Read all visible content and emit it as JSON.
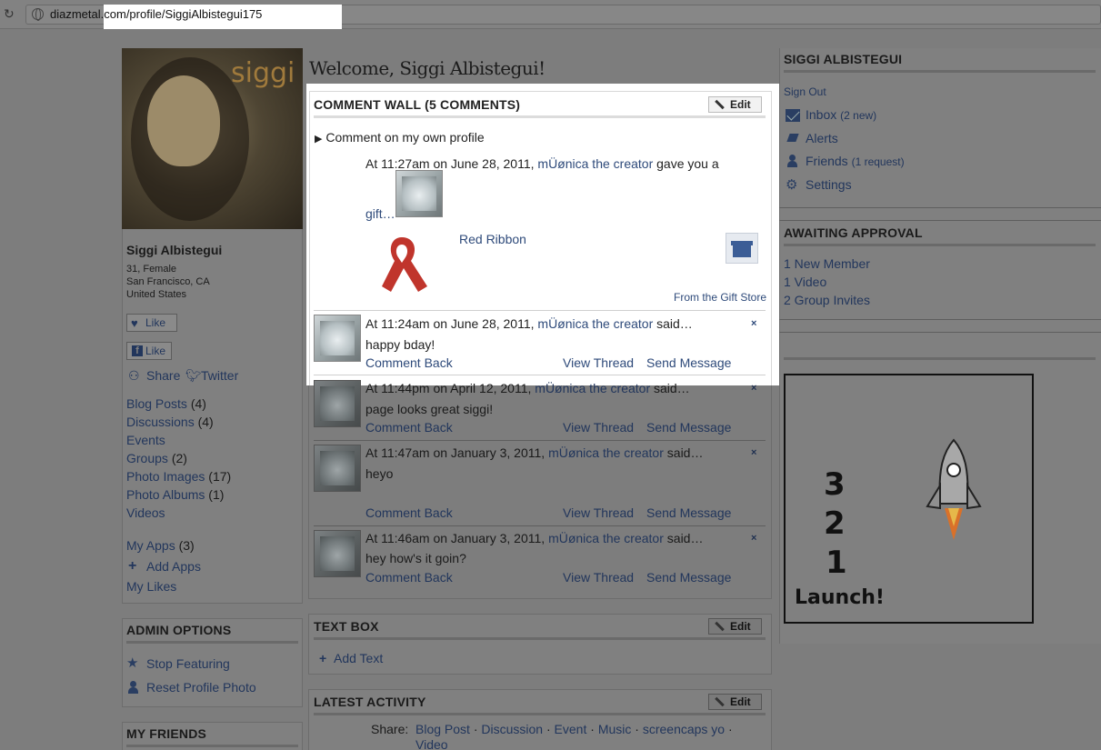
{
  "browser": {
    "url_host": "diazmetal.com",
    "url_path": "/profile/SiggiAlbistegui175"
  },
  "profile": {
    "photo_caption": "siggi",
    "name": "Siggi Albistegui",
    "age_gender": "31, Female",
    "city": "San Francisco, CA",
    "country": "United States",
    "like_label": "Like",
    "fb_like_label": "Like",
    "share_label": "Share",
    "twitter_label": "Twitter"
  },
  "left_nav": [
    {
      "label": "Blog Posts",
      "count": "(4)"
    },
    {
      "label": "Discussions",
      "count": "(4)"
    },
    {
      "label": "Events",
      "count": ""
    },
    {
      "label": "Groups",
      "count": "(2)"
    },
    {
      "label": "Photo Images",
      "count": "(17)"
    },
    {
      "label": "Photo Albums",
      "count": "(1)"
    },
    {
      "label": "Videos",
      "count": ""
    }
  ],
  "apps": {
    "my_apps": "My Apps",
    "my_apps_count": "(3)",
    "add_apps": "Add Apps",
    "my_likes": "My Likes"
  },
  "admin": {
    "title": "ADMIN OPTIONS",
    "stop_featuring": "Stop Featuring",
    "reset_photo": "Reset Profile Photo"
  },
  "friends": {
    "title": "MY FRIENDS"
  },
  "welcome": "Welcome, Siggi Albistegui!",
  "comment_wall": {
    "title": "COMMENT WALL (5 COMMENTS)",
    "edit_label": "Edit",
    "comment_own": "Comment on my own profile",
    "gift": {
      "prefix": "At 11:27am on June 28, 2011,",
      "author": "mÜønica the creator",
      "suffix": "gave you a",
      "gift_link": "gift…",
      "gift_name": "Red Ribbon",
      "from_store": "From the Gift Store"
    },
    "comments": [
      {
        "prefix": "At 11:24am on June 28, 2011,",
        "author": "mÜønica the creator",
        "suffix": "said…",
        "text": "happy bday!"
      },
      {
        "prefix": "At 11:44pm on April 12, 2011,",
        "author": "mÜønica the creator",
        "suffix": "said…",
        "text": "page looks great siggi!"
      },
      {
        "prefix": "At 11:47am on January 3, 2011,",
        "author": "mÜønica the creator",
        "suffix": "said…",
        "text": "heyo"
      },
      {
        "prefix": "At 11:46am on January 3, 2011,",
        "author": "mÜønica the creator",
        "suffix": "said…",
        "text": "hey how's it goin?"
      }
    ],
    "comment_back": "Comment Back",
    "view_thread": "View Thread",
    "send_message": "Send Message",
    "close_glyph": "×"
  },
  "text_box": {
    "title": "TEXT BOX",
    "edit_label": "Edit",
    "add_text": "Add Text"
  },
  "latest_activity": {
    "title": "LATEST ACTIVITY",
    "edit_label": "Edit",
    "share_label": "Share:",
    "links": [
      "Blog Post",
      "Discussion",
      "Event",
      "Music",
      "screencaps yo",
      "Video"
    ],
    "separator": "·"
  },
  "user_menu": {
    "title": "SIGGI ALBISTEGUI",
    "sign_out": "Sign Out",
    "inbox": "Inbox",
    "inbox_count": "(2 new)",
    "alerts": "Alerts",
    "friends": "Friends",
    "friends_count": "(1 request)",
    "settings": "Settings"
  },
  "awaiting": {
    "title": "AWAITING APPROVAL",
    "items": [
      "1 New Member",
      "1 Video",
      "2 Group Invites"
    ]
  },
  "launch": {
    "n3": "3",
    "n2": "2",
    "n1": "1",
    "word": "Launch!"
  },
  "colors": {
    "link": "#2e4a7a",
    "dim_overlay": "#7d7d7d",
    "ribbon": "#c0352c"
  }
}
